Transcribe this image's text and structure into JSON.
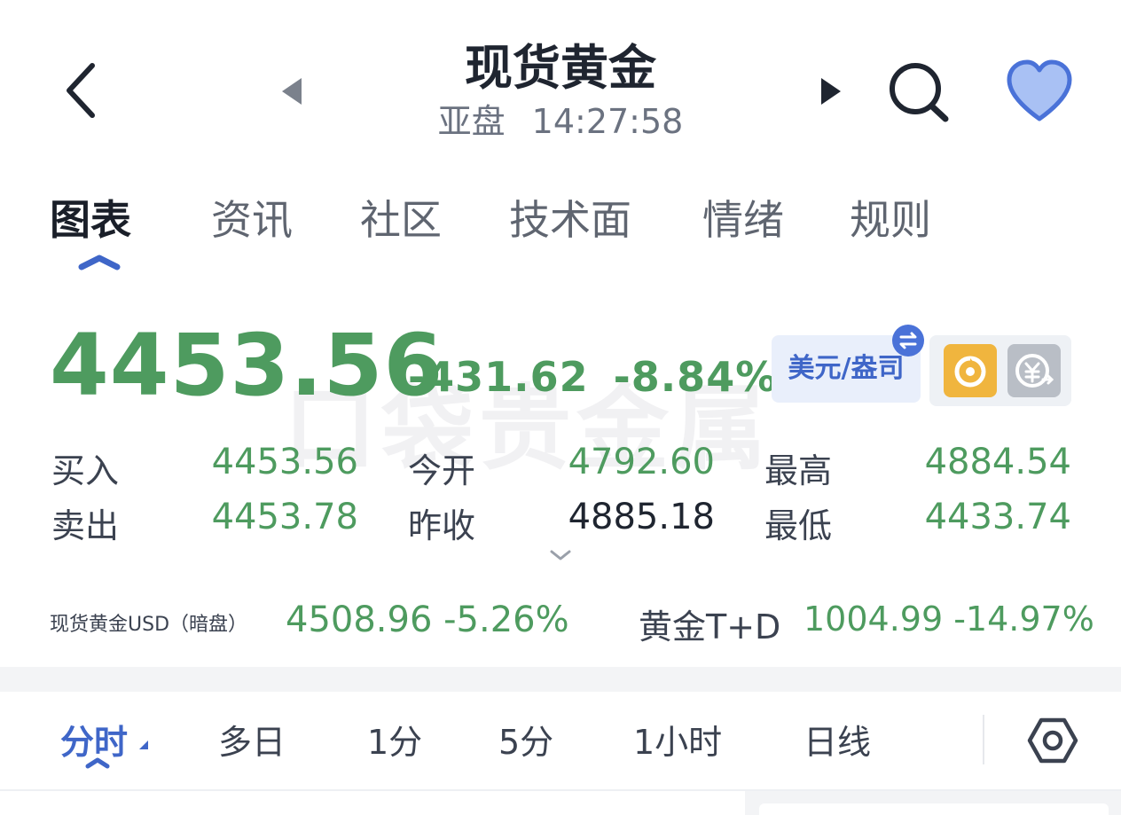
{
  "header": {
    "title": "现货黄金",
    "session": "亚盘",
    "time": "14:27:58"
  },
  "tabs": [
    "图表",
    "资讯",
    "社区",
    "技术面",
    "情绪",
    "规则"
  ],
  "quote": {
    "price": "4453.56",
    "change": "-431.62",
    "change_pct": "-8.84%",
    "watermark": "口袋贵金属",
    "unit_label": "美元/盎司"
  },
  "stats": {
    "bid_label": "买入",
    "bid": "4453.56",
    "ask_label": "卖出",
    "ask": "4453.78",
    "open_label": "今开",
    "open": "4792.60",
    "prev_close_label": "昨收",
    "prev_close": "4885.18",
    "high_label": "最高",
    "high": "4884.54",
    "low_label": "最低",
    "low": "4433.74"
  },
  "related": {
    "item1_label": "现货黄金USD（暗盘）",
    "item1_value": "4508.96 -5.26%",
    "item2_label": "黄金T+D",
    "item2_value": "1004.99 -14.97%"
  },
  "period_tabs": [
    "分时",
    "多日",
    "1分",
    "5分",
    "1小时",
    "日线"
  ],
  "colors": {
    "down_green": "#4e9b5f",
    "accent_blue": "#3f66c8",
    "heart_fill": "#a9c1f4",
    "orange_icon": "#f0b53e"
  },
  "icons": [
    "back-icon",
    "prev-arrow-icon",
    "next-arrow-icon",
    "search-icon",
    "heart-icon",
    "swap-icon",
    "refresh-icon",
    "currency-exchange-icon",
    "chevron-down-icon",
    "settings-hexagon-icon"
  ]
}
